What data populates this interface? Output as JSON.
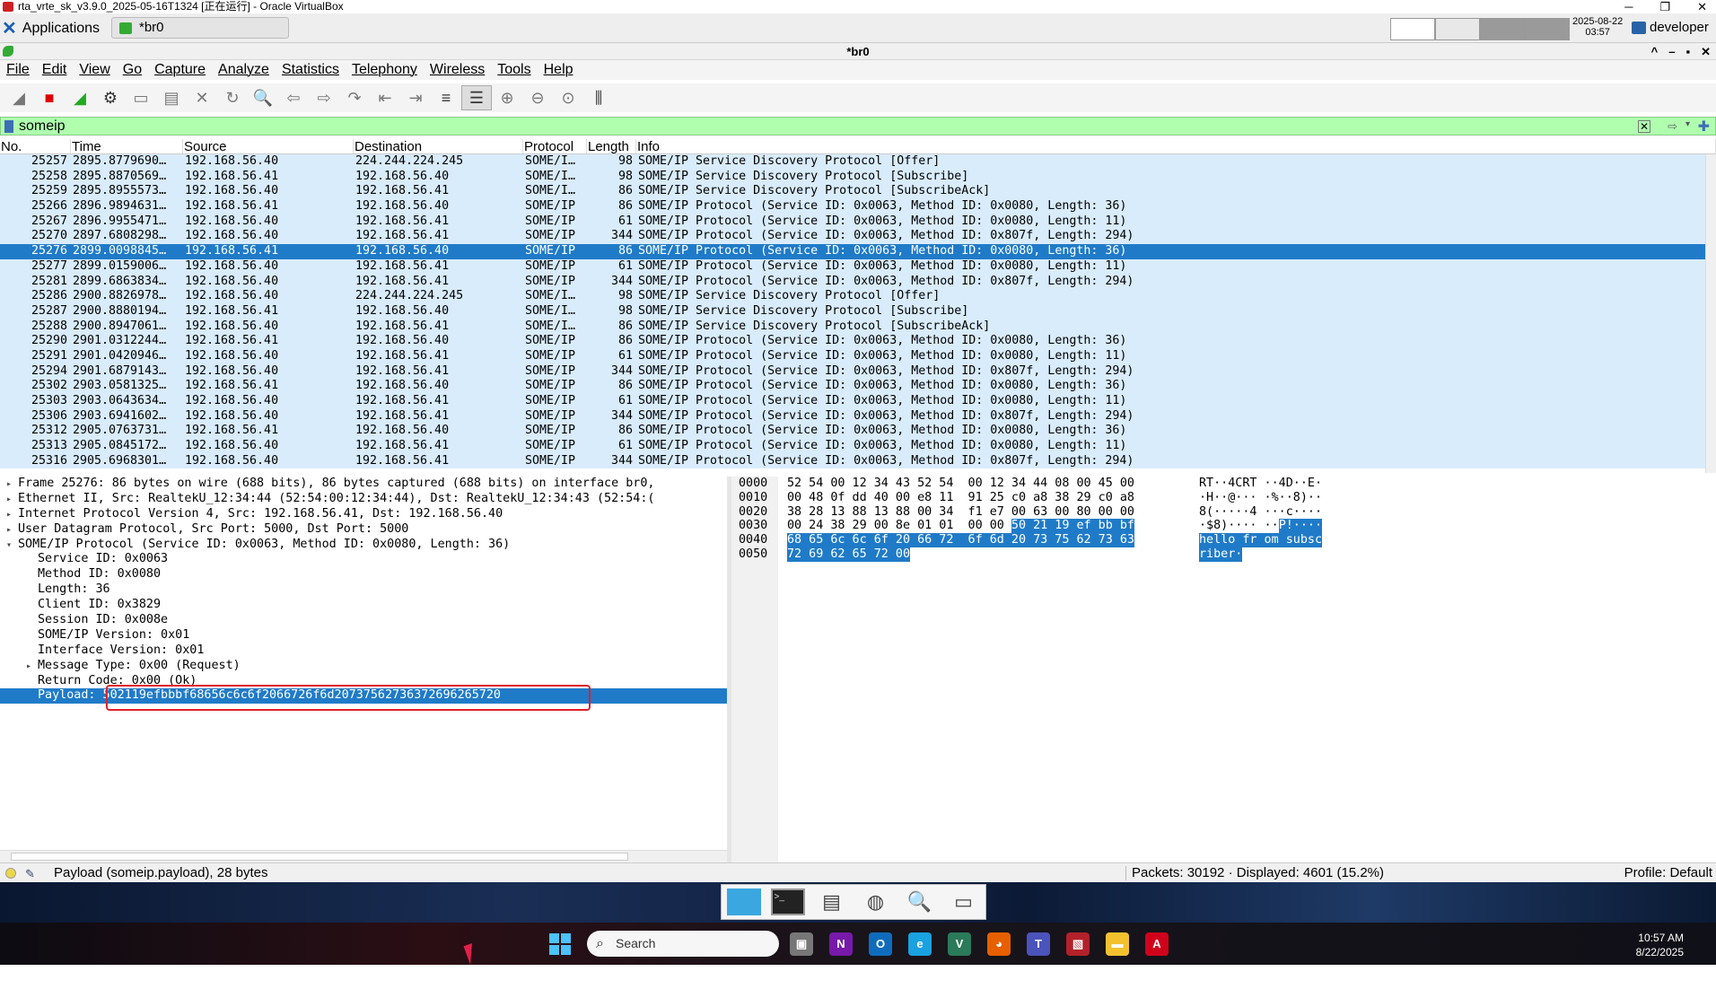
{
  "vbox": {
    "title": "rta_vrte_sk_v3.9.0_2025-05-16T1324 [正在运行] - Oracle VirtualBox",
    "ctrls": [
      "─",
      "❐",
      "✕"
    ]
  },
  "panel": {
    "apps_label": "Applications",
    "task_label": "*br0",
    "clock_date": "2025-08-22",
    "clock_time": "03:57",
    "user": "developer"
  },
  "window": {
    "title": "*br0",
    "ctrls": [
      "^",
      "–",
      "▪",
      "✕"
    ]
  },
  "menu": [
    "File",
    "Edit",
    "View",
    "Go",
    "Capture",
    "Analyze",
    "Statistics",
    "Telephony",
    "Wireless",
    "Tools",
    "Help"
  ],
  "toolbar": [
    {
      "name": "start-capture",
      "glyph": "◢",
      "state": "disabled"
    },
    {
      "name": "stop-capture",
      "glyph": "■",
      "state": "red"
    },
    {
      "name": "restart-capture",
      "glyph": "◢",
      "state": "green"
    },
    {
      "name": "capture-options",
      "glyph": "⚙",
      "state": "normal"
    },
    {
      "name": "open-file",
      "glyph": "▭",
      "state": "disabled"
    },
    {
      "name": "save-file",
      "glyph": "▤",
      "state": "disabled"
    },
    {
      "name": "close-file",
      "glyph": "✕",
      "state": "disabled"
    },
    {
      "name": "reload-file",
      "glyph": "↻",
      "state": "disabled"
    },
    {
      "name": "find-packet",
      "glyph": "🔍",
      "state": "black"
    },
    {
      "name": "go-back",
      "glyph": "⇦",
      "state": "disabled"
    },
    {
      "name": "go-forward",
      "glyph": "⇨",
      "state": "disabled"
    },
    {
      "name": "go-to-packet",
      "glyph": "↷",
      "state": "disabled"
    },
    {
      "name": "go-first",
      "glyph": "⇤",
      "state": "disabled"
    },
    {
      "name": "go-last",
      "glyph": "⇥",
      "state": "disabled"
    },
    {
      "name": "autoscroll",
      "glyph": "≡",
      "state": "black"
    },
    {
      "name": "colorize",
      "glyph": "☰",
      "state": "active"
    },
    {
      "name": "zoom-in",
      "glyph": "⊕",
      "state": "disabled"
    },
    {
      "name": "zoom-out",
      "glyph": "⊖",
      "state": "disabled"
    },
    {
      "name": "zoom-normal",
      "glyph": "⊙",
      "state": "disabled"
    },
    {
      "name": "resize-columns",
      "glyph": "⫼",
      "state": "black"
    }
  ],
  "filter": {
    "value": "someip"
  },
  "packet_list": {
    "columns": [
      "No.",
      "Time",
      "Source",
      "Destination",
      "Protocol",
      "Length",
      "Info"
    ],
    "selected_index": 6,
    "rows": [
      [
        "25257",
        "2895.8779690…",
        "192.168.56.40",
        "224.244.224.245",
        "SOME/I…",
        "98",
        "SOME/IP Service Discovery Protocol [Offer]"
      ],
      [
        "25258",
        "2895.8870569…",
        "192.168.56.41",
        "192.168.56.40",
        "SOME/I…",
        "98",
        "SOME/IP Service Discovery Protocol [Subscribe]"
      ],
      [
        "25259",
        "2895.8955573…",
        "192.168.56.40",
        "192.168.56.41",
        "SOME/I…",
        "86",
        "SOME/IP Service Discovery Protocol [SubscribeAck]"
      ],
      [
        "25266",
        "2896.9894631…",
        "192.168.56.41",
        "192.168.56.40",
        "SOME/IP",
        "86",
        "SOME/IP Protocol (Service ID: 0x0063, Method ID: 0x0080, Length: 36)"
      ],
      [
        "25267",
        "2896.9955471…",
        "192.168.56.40",
        "192.168.56.41",
        "SOME/IP",
        "61",
        "SOME/IP Protocol (Service ID: 0x0063, Method ID: 0x0080, Length: 11)"
      ],
      [
        "25270",
        "2897.6808298…",
        "192.168.56.40",
        "192.168.56.41",
        "SOME/IP",
        "344",
        "SOME/IP Protocol (Service ID: 0x0063, Method ID: 0x807f, Length: 294)"
      ],
      [
        "25276",
        "2899.0098845…",
        "192.168.56.41",
        "192.168.56.40",
        "SOME/IP",
        "86",
        "SOME/IP Protocol (Service ID: 0x0063, Method ID: 0x0080, Length: 36)"
      ],
      [
        "25277",
        "2899.0159006…",
        "192.168.56.40",
        "192.168.56.41",
        "SOME/IP",
        "61",
        "SOME/IP Protocol (Service ID: 0x0063, Method ID: 0x0080, Length: 11)"
      ],
      [
        "25281",
        "2899.6863834…",
        "192.168.56.40",
        "192.168.56.41",
        "SOME/IP",
        "344",
        "SOME/IP Protocol (Service ID: 0x0063, Method ID: 0x807f, Length: 294)"
      ],
      [
        "25286",
        "2900.8826978…",
        "192.168.56.40",
        "224.244.224.245",
        "SOME/I…",
        "98",
        "SOME/IP Service Discovery Protocol [Offer]"
      ],
      [
        "25287",
        "2900.8880194…",
        "192.168.56.41",
        "192.168.56.40",
        "SOME/I…",
        "98",
        "SOME/IP Service Discovery Protocol [Subscribe]"
      ],
      [
        "25288",
        "2900.8947061…",
        "192.168.56.40",
        "192.168.56.41",
        "SOME/I…",
        "86",
        "SOME/IP Service Discovery Protocol [SubscribeAck]"
      ],
      [
        "25290",
        "2901.0312244…",
        "192.168.56.41",
        "192.168.56.40",
        "SOME/IP",
        "86",
        "SOME/IP Protocol (Service ID: 0x0063, Method ID: 0x0080, Length: 36)"
      ],
      [
        "25291",
        "2901.0420946…",
        "192.168.56.40",
        "192.168.56.41",
        "SOME/IP",
        "61",
        "SOME/IP Protocol (Service ID: 0x0063, Method ID: 0x0080, Length: 11)"
      ],
      [
        "25294",
        "2901.6879143…",
        "192.168.56.40",
        "192.168.56.41",
        "SOME/IP",
        "344",
        "SOME/IP Protocol (Service ID: 0x0063, Method ID: 0x807f, Length: 294)"
      ],
      [
        "25302",
        "2903.0581325…",
        "192.168.56.41",
        "192.168.56.40",
        "SOME/IP",
        "86",
        "SOME/IP Protocol (Service ID: 0x0063, Method ID: 0x0080, Length: 36)"
      ],
      [
        "25303",
        "2903.0643634…",
        "192.168.56.40",
        "192.168.56.41",
        "SOME/IP",
        "61",
        "SOME/IP Protocol (Service ID: 0x0063, Method ID: 0x0080, Length: 11)"
      ],
      [
        "25306",
        "2903.6941602…",
        "192.168.56.40",
        "192.168.56.41",
        "SOME/IP",
        "344",
        "SOME/IP Protocol (Service ID: 0x0063, Method ID: 0x807f, Length: 294)"
      ],
      [
        "25312",
        "2905.0763731…",
        "192.168.56.41",
        "192.168.56.40",
        "SOME/IP",
        "86",
        "SOME/IP Protocol (Service ID: 0x0063, Method ID: 0x0080, Length: 36)"
      ],
      [
        "25313",
        "2905.0845172…",
        "192.168.56.40",
        "192.168.56.41",
        "SOME/IP",
        "61",
        "SOME/IP Protocol (Service ID: 0x0063, Method ID: 0x0080, Length: 11)"
      ],
      [
        "25316",
        "2905.6968301…",
        "192.168.56.40",
        "192.168.56.41",
        "SOME/IP",
        "344",
        "SOME/IP Protocol (Service ID: 0x0063, Method ID: 0x807f, Length: 294)"
      ]
    ]
  },
  "details": {
    "selected_index": 14,
    "rows": [
      {
        "text": "Frame 25276: 86 bytes on wire (688 bits), 86 bytes captured (688 bits) on interface br0,",
        "indent": 0,
        "arrow": "▸"
      },
      {
        "text": "Ethernet II, Src: RealtekU_12:34:44 (52:54:00:12:34:44), Dst: RealtekU_12:34:43 (52:54:(",
        "indent": 0,
        "arrow": "▸"
      },
      {
        "text": "Internet Protocol Version 4, Src: 192.168.56.41, Dst: 192.168.56.40",
        "indent": 0,
        "arrow": "▸"
      },
      {
        "text": "User Datagram Protocol, Src Port: 5000, Dst Port: 5000",
        "indent": 0,
        "arrow": "▸"
      },
      {
        "text": "SOME/IP Protocol (Service ID: 0x0063, Method ID: 0x0080, Length: 36)",
        "indent": 0,
        "arrow": "▾"
      },
      {
        "text": "Service ID: 0x0063",
        "indent": 1,
        "arrow": ""
      },
      {
        "text": "Method ID: 0x0080",
        "indent": 1,
        "arrow": ""
      },
      {
        "text": "Length: 36",
        "indent": 1,
        "arrow": ""
      },
      {
        "text": "Client ID: 0x3829",
        "indent": 1,
        "arrow": ""
      },
      {
        "text": "Session ID: 0x008e",
        "indent": 1,
        "arrow": ""
      },
      {
        "text": "SOME/IP Version: 0x01",
        "indent": 1,
        "arrow": ""
      },
      {
        "text": "Interface Version: 0x01",
        "indent": 1,
        "arrow": ""
      },
      {
        "text": "Message Type: 0x00 (Request)",
        "indent": 1,
        "arrow": "▸"
      },
      {
        "text": "Return Code: 0x00 (Ok)",
        "indent": 1,
        "arrow": ""
      },
      {
        "text": "Payload: 502119efbbbf68656c6c6f2066726f6d20737562736372696265720",
        "indent": 1,
        "arrow": ""
      }
    ]
  },
  "bytes": {
    "rows": [
      {
        "offset": "0000",
        "hex_plain": "52 54 00 12 34 43 52 54  00 12 34 44 08 00 45 00",
        "hex_hl": "",
        "ascii_plain": "RT··4CRT ··4D··E·",
        "ascii_hl": ""
      },
      {
        "offset": "0010",
        "hex_plain": "00 48 0f dd 40 00 e8 11  91 25 c0 a8 38 29 c0 a8",
        "hex_hl": "",
        "ascii_plain": "·H··@··· ·%··8)··",
        "ascii_hl": ""
      },
      {
        "offset": "0020",
        "hex_plain": "38 28 13 88 13 88 00 34  f1 e7 00 63 00 80 00 00",
        "hex_hl": "",
        "ascii_plain": "8(·····4 ···c····",
        "ascii_hl": ""
      },
      {
        "offset": "0030",
        "hex_plain": "00 24 38 29 00 8e 01 01  00 00 ",
        "hex_hl": "50 21 19 ef bb bf",
        "ascii_plain": "·$8)···· ··",
        "ascii_hl": "P!····"
      },
      {
        "offset": "0040",
        "hex_plain": "",
        "hex_hl": "68 65 6c 6c 6f 20 66 72  6f 6d 20 73 75 62 73 63",
        "ascii_plain": "",
        "ascii_hl": "hello fr om subsc"
      },
      {
        "offset": "0050",
        "hex_plain": "",
        "hex_hl": "72 69 62 65 72 00",
        "ascii_plain": "",
        "ascii_hl": "riber·"
      }
    ]
  },
  "status": {
    "message": "Payload (someip.payload), 28 bytes",
    "packets": "Packets: 30192 · Displayed: 4601 (15.2%)",
    "profile": "Profile: Default"
  },
  "taskbar": {
    "search_placeholder": "Search",
    "time": "10:57 AM",
    "date": "8/22/2025"
  }
}
